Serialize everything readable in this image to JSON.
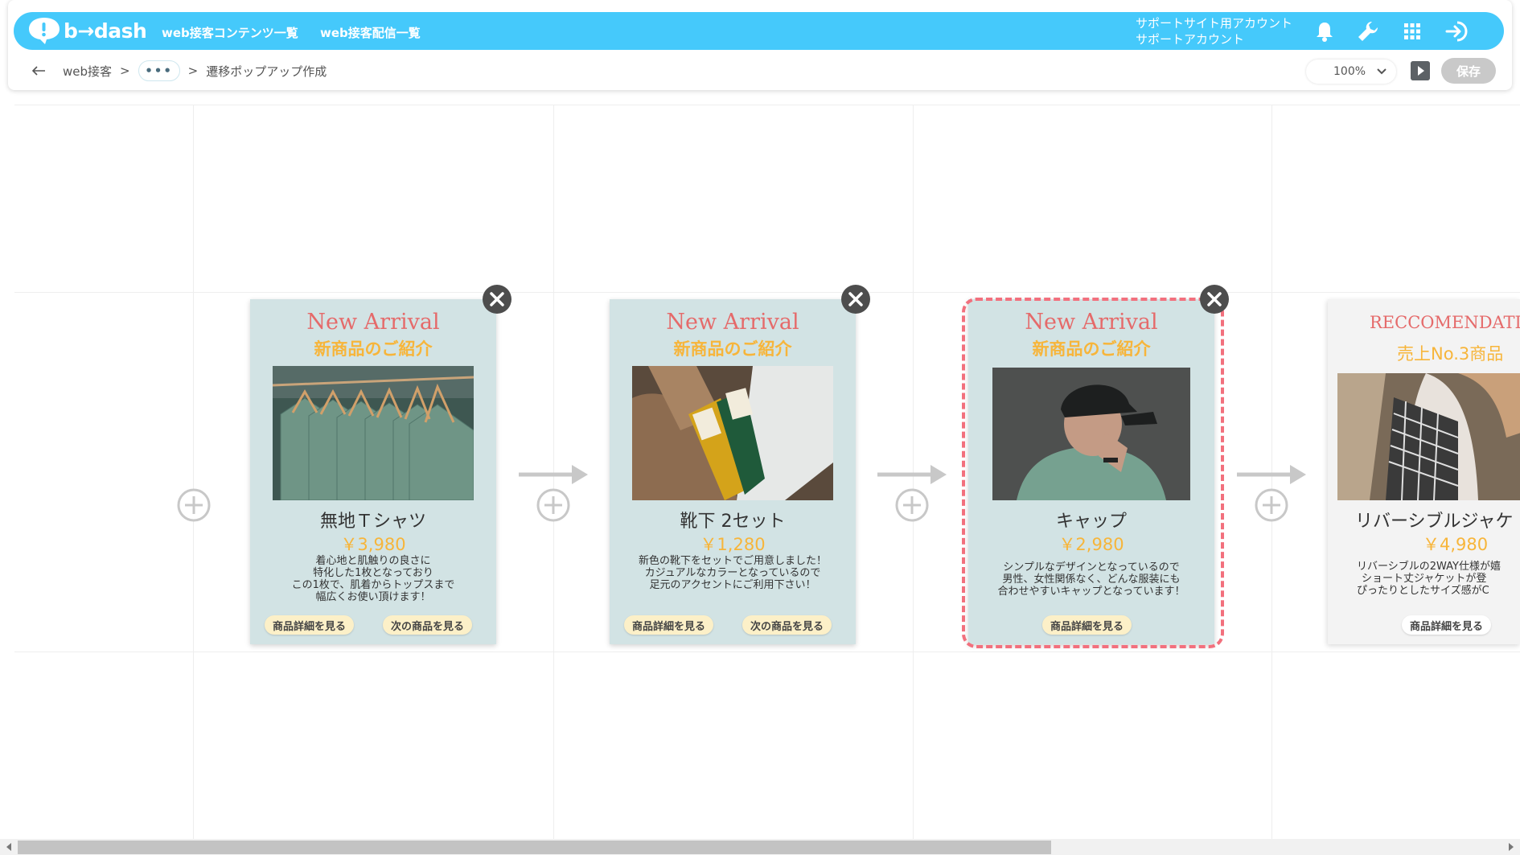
{
  "header": {
    "logo_text": "b→dash",
    "nav": [
      "web接客コンテンツ一覧",
      "web接客配信一覧"
    ],
    "account_line1": "サポートサイト用アカウント",
    "account_line2": "サポートアカウント",
    "icons": [
      "bell-icon",
      "wrench-icon",
      "grid-icon",
      "logout-icon"
    ],
    "color": "#45c9fb"
  },
  "breadcrumb": {
    "item1": "web接客",
    "sep": ">",
    "ellipsis": "•••",
    "current": "遷移ポップアップ作成"
  },
  "toolbar": {
    "zoom": "100%",
    "save_label": "保存"
  },
  "cards": [
    {
      "head": "New Arrival",
      "sub": "新商品のご紹介",
      "name": "無地Ｔシャツ",
      "price": "￥3,980",
      "desc": [
        "着心地と肌触りの良さに",
        "特化した1枚となっており",
        "この1枚で、肌着からトップスまで",
        "幅広くお使い頂けます！"
      ],
      "btn1": "商品詳細を見る",
      "btn2": "次の商品を見る"
    },
    {
      "head": "New Arrival",
      "sub": "新商品のご紹介",
      "name": "靴下 2セット",
      "price": "￥1,280",
      "desc": [
        "新色の靴下をセットでご用意しました！",
        "カジュアルなカラーとなっているので",
        "足元のアクセントにご利用下さい！"
      ],
      "btn1": "商品詳細を見る",
      "btn2": "次の商品を見る"
    },
    {
      "head": "New Arrival",
      "sub": "新商品のご紹介",
      "name": "キャップ",
      "price": "￥2,980",
      "desc": [
        "シンプルなデザインとなっているので",
        "男性、女性関係なく、どんな服装にも",
        "合わせやすいキャップとなっています！"
      ],
      "btn1": "商品詳細を見る"
    },
    {
      "head": "RECCOMENDATIO",
      "sub": "売上No.3商品",
      "name": "リバーシブルジャケ",
      "price": "￥4,980",
      "desc": [
        "リバーシブルの2WAY仕様が嬉",
        "ショート丈ジャケットが登",
        "ぴったりとしたサイズ感がC"
      ],
      "btn1": "商品詳細を見る"
    }
  ]
}
